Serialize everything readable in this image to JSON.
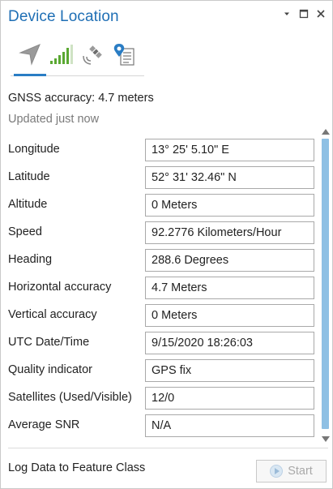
{
  "window": {
    "title": "Device Location",
    "controls": [
      "chevron-down-icon",
      "maximize-icon",
      "close-icon"
    ]
  },
  "tabs": [
    {
      "name": "navigation",
      "icon": "location-arrow-icon",
      "selected": true
    },
    {
      "name": "signal",
      "icon": "signal-bars-icon",
      "selected": false
    },
    {
      "name": "satellite",
      "icon": "satellite-icon",
      "selected": false
    },
    {
      "name": "device-log",
      "icon": "location-log-icon",
      "selected": false
    }
  ],
  "status": {
    "accuracy": "GNSS accuracy: 4.7 meters",
    "updated": "Updated just now"
  },
  "fields": [
    {
      "label": "Longitude",
      "value": "13° 25' 5.10\" E"
    },
    {
      "label": "Latitude",
      "value": "52° 31' 32.46\" N"
    },
    {
      "label": "Altitude",
      "value": "0 Meters"
    },
    {
      "label": "Speed",
      "value": "92.2776 Kilometers/Hour"
    },
    {
      "label": "Heading",
      "value": "288.6 Degrees"
    },
    {
      "label": "Horizontal accuracy",
      "value": "4.7 Meters"
    },
    {
      "label": "Vertical accuracy",
      "value": "0 Meters"
    },
    {
      "label": "UTC Date/Time",
      "value": "9/15/2020 18:26:03"
    },
    {
      "label": "Quality indicator",
      "value": "GPS fix"
    },
    {
      "label": "Satellites (Used/Visible)",
      "value": "12/0"
    },
    {
      "label": "Average SNR",
      "value": "N/A"
    }
  ],
  "footer": {
    "log_label": "Log Data to Feature Class",
    "start_label": "Start"
  },
  "colors": {
    "accent": "#1f6fb5",
    "signal_green": "#5aa832",
    "scrollbar": "#8fc0e4"
  }
}
